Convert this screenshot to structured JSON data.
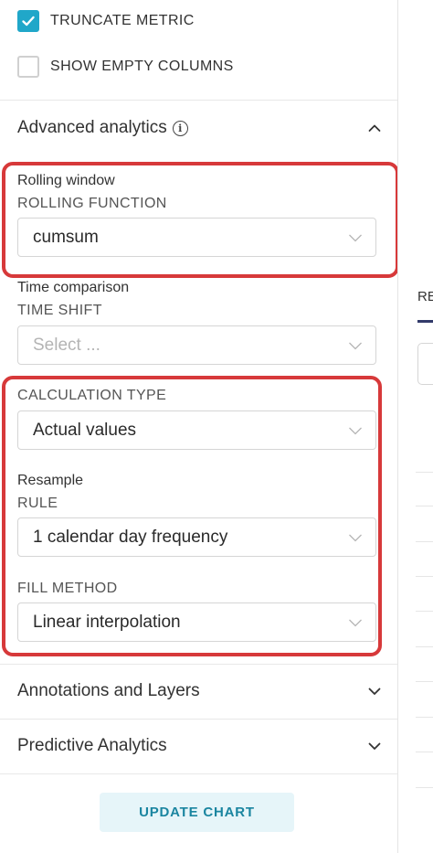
{
  "checkboxes": {
    "truncate_metric": {
      "label": "TRUNCATE METRIC",
      "checked": true
    },
    "show_empty_columns": {
      "label": "SHOW EMPTY COLUMNS",
      "checked": false
    }
  },
  "advanced_analytics": {
    "title": "Advanced analytics",
    "expanded": true,
    "rolling_window": {
      "title": "Rolling window",
      "function_label": "ROLLING FUNCTION",
      "function_value": "cumsum"
    },
    "time_comparison": {
      "title": "Time comparison",
      "shift_label": "TIME SHIFT",
      "shift_placeholder": "Select ...",
      "calc_type_label": "CALCULATION TYPE",
      "calc_type_value": "Actual values"
    },
    "resample": {
      "title": "Resample",
      "rule_label": "RULE",
      "rule_value": "1 calendar day frequency",
      "fill_label": "FILL METHOD",
      "fill_value": "Linear interpolation"
    }
  },
  "sections": {
    "annotations": "Annotations and Layers",
    "predictive": "Predictive Analytics"
  },
  "update_button": "UPDATE CHART",
  "right_pane": {
    "tab_partial": "RE"
  },
  "colors": {
    "accent": "#20a7c9",
    "highlight": "#d7393a",
    "button_bg": "#e6f5f9"
  },
  "icons": [
    "check-icon",
    "info-icon",
    "chevron-up-icon",
    "chevron-down-icon"
  ]
}
